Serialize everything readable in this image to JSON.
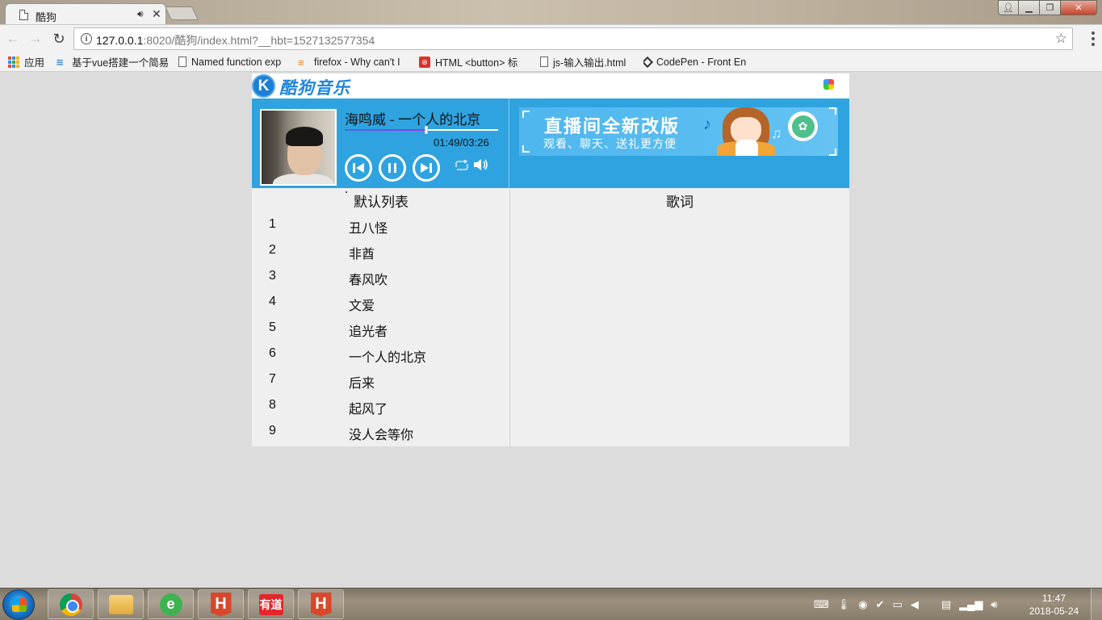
{
  "browser": {
    "tab_title": "酷狗",
    "url_host": "127.0.0.1",
    "url_rest": ":8020/酷狗/index.html?__hbt=1527132577354",
    "bookmarks": [
      {
        "label": "应用",
        "icon": "apps-icon"
      },
      {
        "label": "基于vue搭建一个简易",
        "icon": "vue-icon"
      },
      {
        "label": "Named function exp",
        "icon": "page-icon"
      },
      {
        "label": "firefox - Why can't I",
        "icon": "stackoverflow-icon"
      },
      {
        "label": "HTML <button> 标",
        "icon": "runoob-icon"
      },
      {
        "label": "js-输入输出.html",
        "icon": "page-icon"
      },
      {
        "label": "CodePen - Front En",
        "icon": "codepen-icon"
      }
    ]
  },
  "app": {
    "logo_letter": "K",
    "logo_text": "酷狗音乐",
    "player": {
      "song_title": "海鸣威 - 一个人的北京",
      "time": "01:49/03:26",
      "progress": 0.53
    },
    "banner": {
      "title": "直播间全新改版",
      "subtitle": "观看、聊天、送礼更方便"
    },
    "playlist": {
      "heading": "默认列表",
      "songs": [
        {
          "num": "1",
          "name": "丑八怪"
        },
        {
          "num": "2",
          "name": "非酋"
        },
        {
          "num": "3",
          "name": "春风吹"
        },
        {
          "num": "4",
          "name": "文爱"
        },
        {
          "num": "5",
          "name": "追光者"
        },
        {
          "num": "6",
          "name": "一个人的北京"
        },
        {
          "num": "7",
          "name": "后来"
        },
        {
          "num": "8",
          "name": "起风了"
        },
        {
          "num": "9",
          "name": "没人会等你"
        }
      ]
    },
    "lyrics": {
      "heading": "歌词"
    }
  },
  "taskbar": {
    "time": "11:47",
    "date": "2018-05-24"
  },
  "colors": {
    "player_bg": "#2fa3e0",
    "brand_blue": "#1f86e0",
    "list_bg": "#efefef"
  }
}
